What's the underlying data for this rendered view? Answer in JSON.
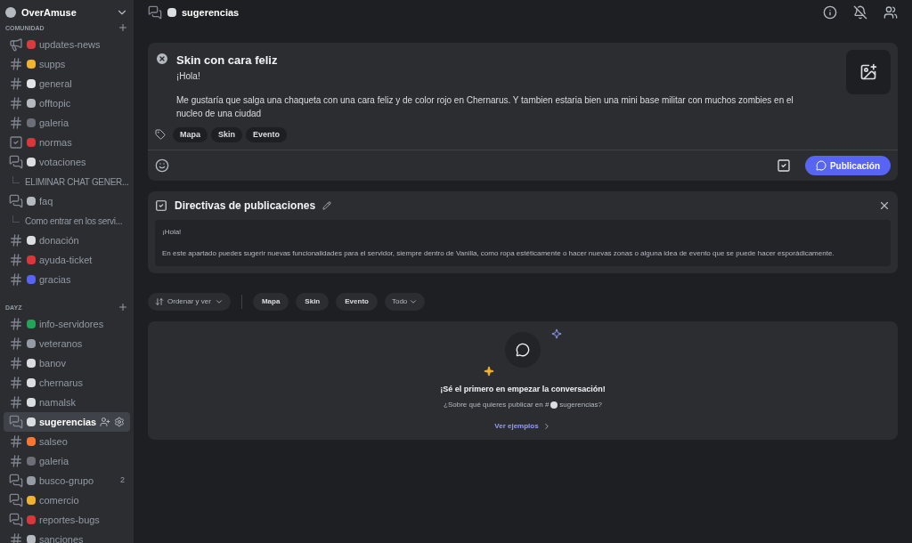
{
  "server": {
    "name": "OverAmuse"
  },
  "categories": [
    {
      "name": "COMUNIDAD",
      "channels": [
        {
          "kind": "announcement",
          "name": "updates-news",
          "color": "#d83c3e",
          "selected": false
        },
        {
          "kind": "text",
          "name": "supps",
          "color": "#f0b232",
          "selected": false
        },
        {
          "kind": "text",
          "name": "general",
          "color": "#e3e5e8",
          "selected": false
        },
        {
          "kind": "text",
          "name": "offtopic",
          "color": "#b5bac1",
          "selected": false
        },
        {
          "kind": "text",
          "name": "galeria",
          "color": "#6d6f78",
          "selected": false
        },
        {
          "kind": "rules",
          "name": "normas",
          "color": "#da373c",
          "selected": false
        },
        {
          "kind": "forum",
          "name": "votaciones",
          "color": "#dbdee1",
          "selected": false
        },
        {
          "kind": "thread",
          "name": "ELIMINAR CHAT GENER...",
          "selected": false
        },
        {
          "kind": "forum",
          "name": "faq",
          "color": "#b5bac1",
          "selected": false
        },
        {
          "kind": "thread",
          "name": "Como entrar en los servi...",
          "selected": false
        },
        {
          "kind": "text",
          "name": "donación",
          "color": "#dbdee1",
          "selected": false
        },
        {
          "kind": "text",
          "name": "ayuda-ticket",
          "color": "#da373c",
          "selected": false
        },
        {
          "kind": "text",
          "name": "gracias",
          "color": "#5865f2",
          "selected": false
        }
      ]
    },
    {
      "name": "DAYZ",
      "channels": [
        {
          "kind": "text",
          "name": "info-servidores",
          "color": "#23a559",
          "selected": false
        },
        {
          "kind": "text",
          "name": "veteranos",
          "color": "#949ba4",
          "selected": false
        },
        {
          "kind": "text",
          "name": "banov",
          "color": "#dbdee1",
          "selected": false
        },
        {
          "kind": "text",
          "name": "chernarus",
          "color": "#dbdee1",
          "selected": false
        },
        {
          "kind": "text",
          "name": "namalsk",
          "color": "#dbdee1",
          "selected": false
        },
        {
          "kind": "forum",
          "name": "sugerencias",
          "color": "#dbdee1",
          "selected": true
        },
        {
          "kind": "text",
          "name": "salseo",
          "color": "#f57731",
          "selected": false
        },
        {
          "kind": "text",
          "name": "galeria",
          "color": "#6d6f78",
          "selected": false
        },
        {
          "kind": "forum",
          "name": "busco-grupo",
          "color": "#949ba4",
          "badge": "2",
          "selected": false
        },
        {
          "kind": "forum",
          "name": "comercio",
          "color": "#f0b232",
          "selected": false
        },
        {
          "kind": "forum",
          "name": "reportes-bugs",
          "color": "#da373c",
          "selected": false
        },
        {
          "kind": "text",
          "name": "sanciones",
          "color": "#b5bac1",
          "selected": false
        }
      ]
    }
  ],
  "header": {
    "channel": "sugerencias"
  },
  "draft": {
    "title": "Skin con cara feliz",
    "body": [
      "¡Hola!",
      "Me gustaría que salga una chaqueta con una cara feliz y de color rojo en Chernarus. Y tambien estaria bien una mini base militar con muchos zombies en el nucleo de una ciudad"
    ],
    "tags": [
      "Mapa",
      "Skin",
      "Evento"
    ],
    "submit": "Publicación"
  },
  "guidelines": {
    "title": "Directivas de publicaciones",
    "paragraphs": [
      "¡Hola!",
      "En este apartado puedes sugerir nuevas funcionalidades para el servidor, siempre dentro de Vanilla, como ropa estéticamente o hacer nuevas zonas o alguna idea de evento que se puede hacer esporádicamente."
    ]
  },
  "filters": {
    "sort": "Ordenar y ver",
    "tags": [
      "Mapa",
      "Skin",
      "Evento"
    ],
    "all": "Todo"
  },
  "empty": {
    "title": "¡Sé el primero en empezar la conversación!",
    "prompt": "¿Sobre qué quieres publicar en #",
    "channel": "sugerencias?",
    "link": "Ver ejemplos"
  }
}
